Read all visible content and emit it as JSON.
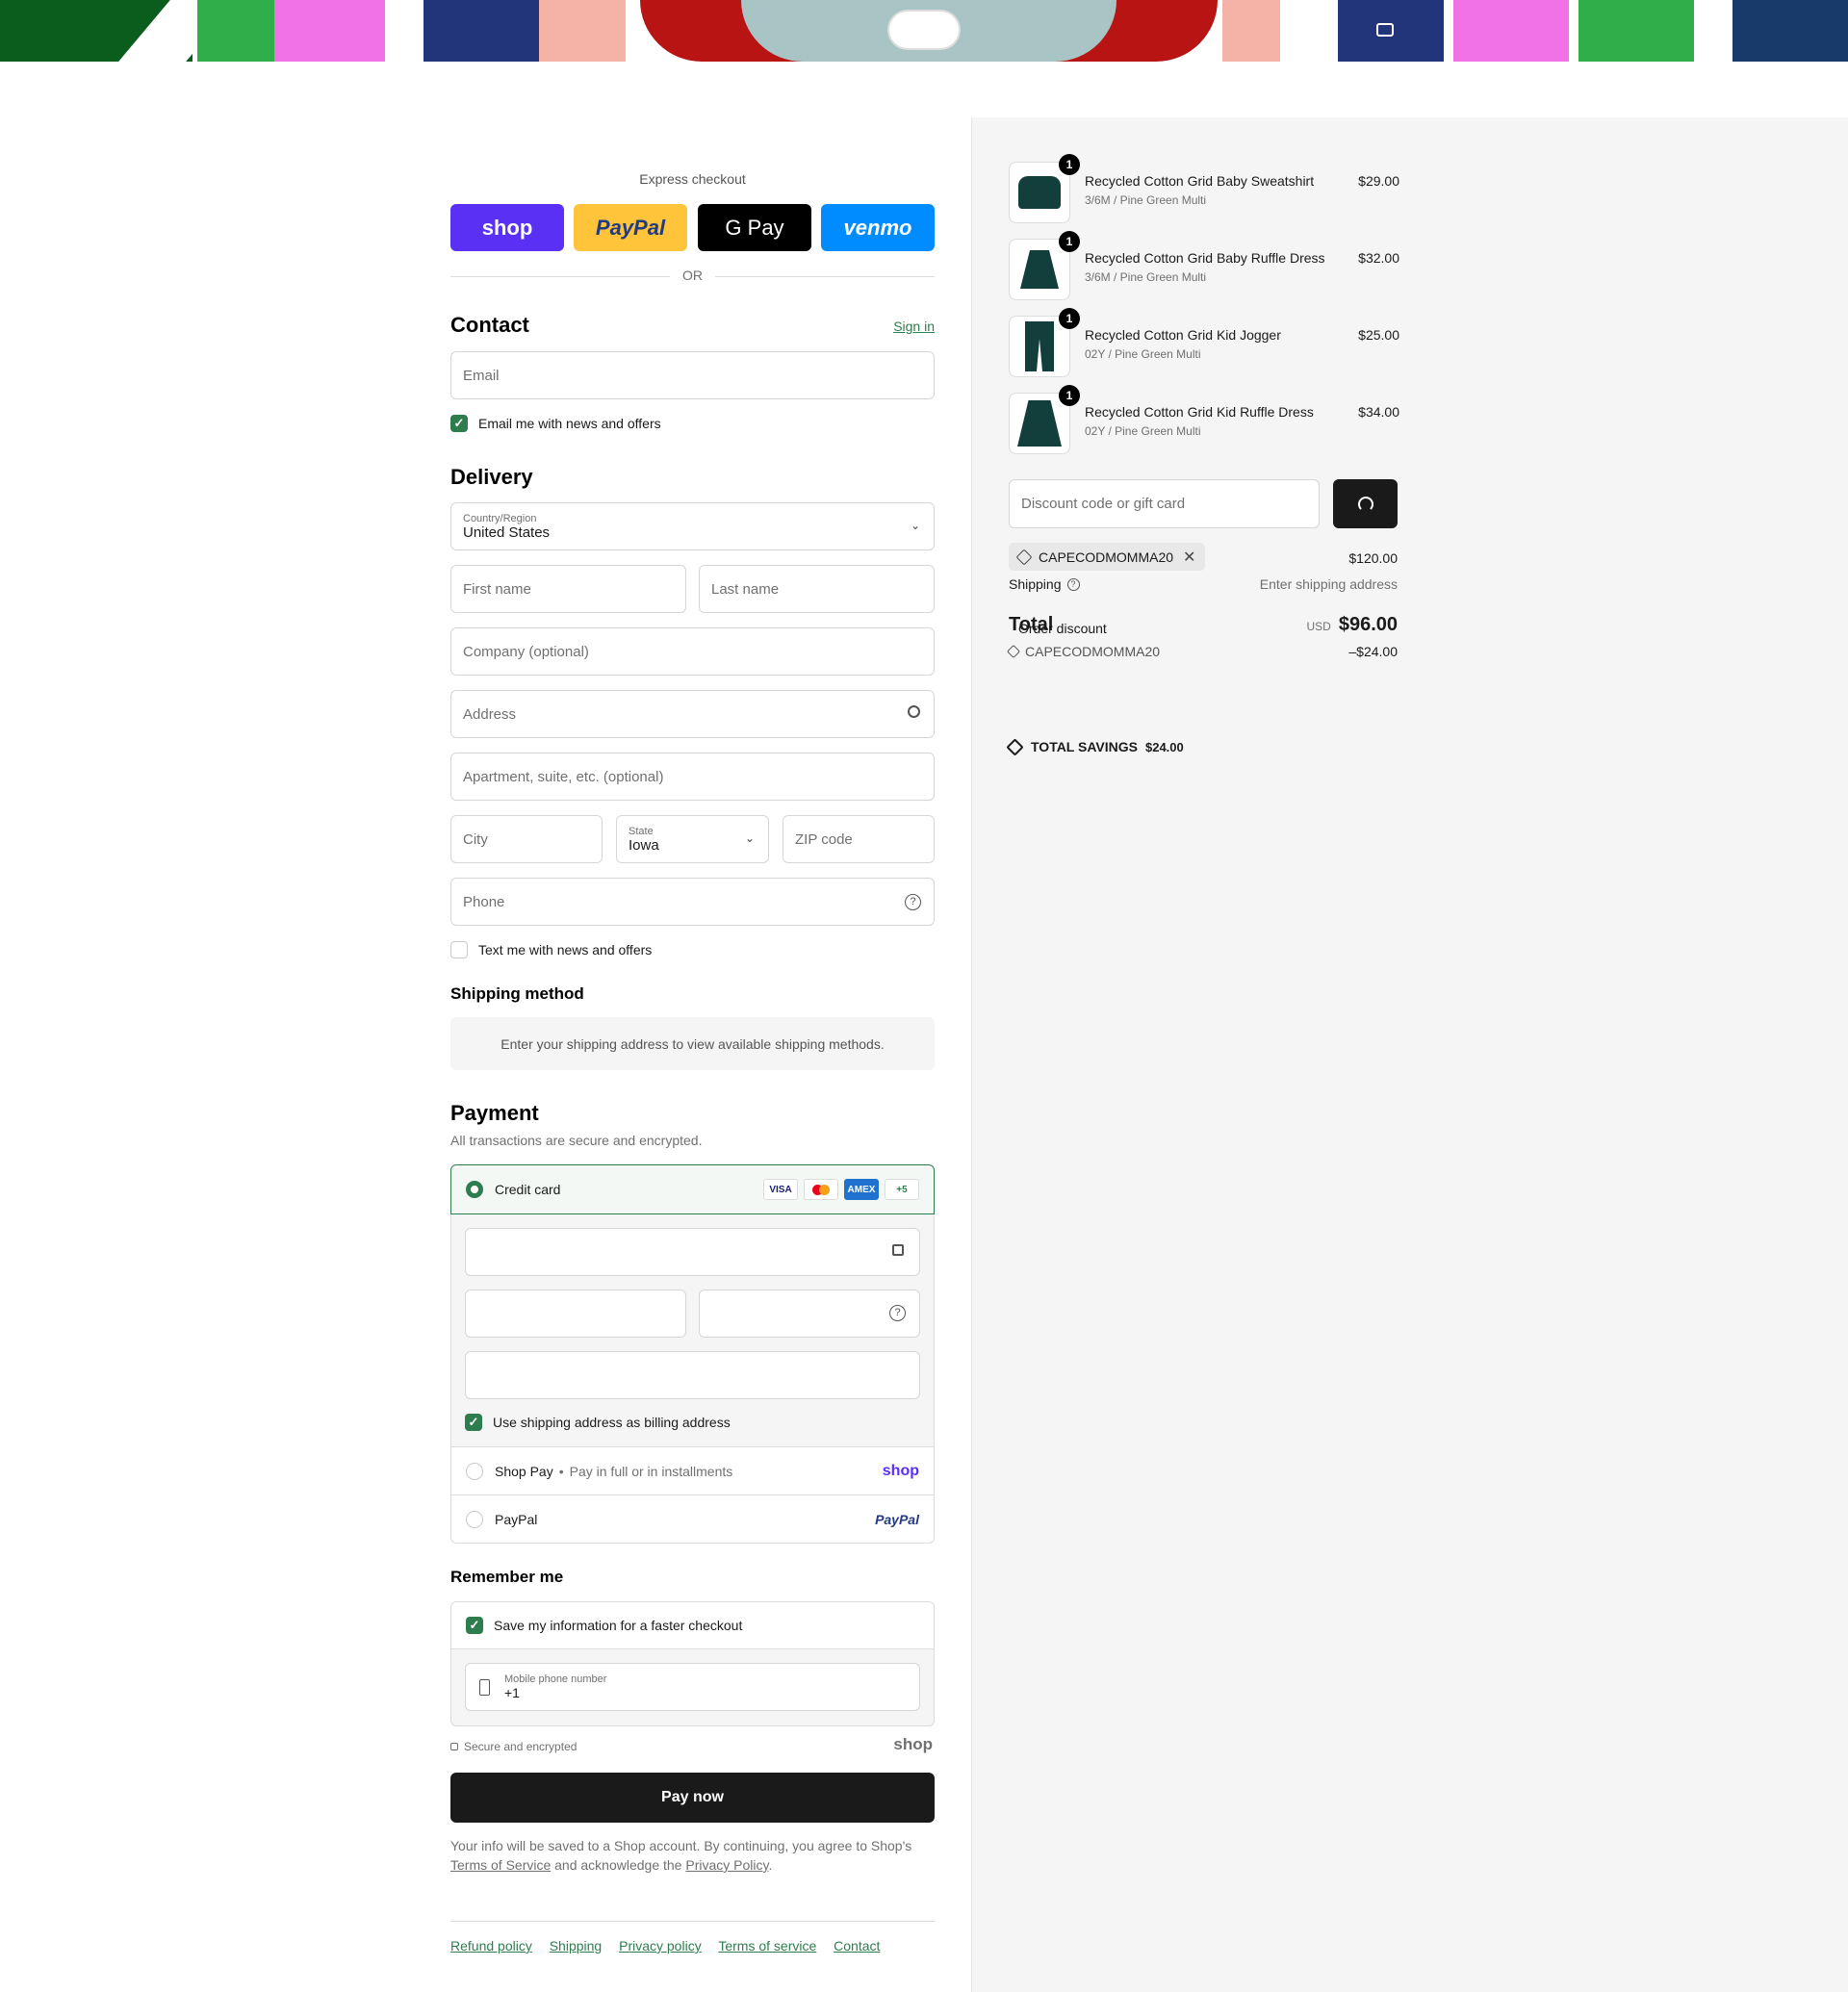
{
  "express": {
    "title": "Express checkout",
    "buttons": [
      "shop",
      "PayPal",
      "G Pay",
      "venmo"
    ],
    "or": "OR"
  },
  "contact": {
    "heading": "Contact",
    "sign_in": "Sign in",
    "email_placeholder": "Email",
    "email_news_label": "Email me with news and offers",
    "email_news_checked": true
  },
  "delivery": {
    "heading": "Delivery",
    "country_label": "Country/Region",
    "country_value": "United States",
    "first_name": "First name",
    "last_name": "Last name",
    "company": "Company (optional)",
    "address": "Address",
    "apartment": "Apartment, suite, etc. (optional)",
    "city": "City",
    "state_label": "State",
    "state_value": "Iowa",
    "zip": "ZIP code",
    "phone": "Phone",
    "text_news_label": "Text me with news and offers",
    "text_news_checked": false
  },
  "shipping_method": {
    "heading": "Shipping method",
    "message": "Enter your shipping address to view available shipping methods."
  },
  "payment": {
    "heading": "Payment",
    "subtitle": "All transactions are secure and encrypted.",
    "credit_card_label": "Credit card",
    "card_logos": [
      "VISA",
      "MC",
      "AMEX",
      "+5"
    ],
    "billing_label": "Use shipping address as billing address",
    "billing_checked": true,
    "shop_pay_label": "Shop Pay",
    "shop_pay_sub": "Pay in full or in installments",
    "shop_pay_logo": "shop",
    "paypal_label": "PayPal",
    "paypal_logo": "PayPal"
  },
  "remember": {
    "heading": "Remember me",
    "save_label": "Save my information for a faster checkout",
    "save_checked": true,
    "mobile_label": "Mobile phone number",
    "mobile_value": "+1",
    "secure_label": "Secure and encrypted",
    "shop_logo": "shop"
  },
  "pay_button": "Pay now",
  "legal": {
    "text1": "Your info will be saved to a Shop account. By continuing, you agree to Shop's",
    "tos": "Terms of Service",
    "text2": "and acknowledge the",
    "privacy": "Privacy Policy",
    "end": "."
  },
  "footer_links": [
    "Refund policy",
    "Shipping",
    "Privacy policy",
    "Terms of service",
    "Contact"
  ],
  "cart": {
    "items": [
      {
        "name": "Recycled Cotton Grid Baby Sweatshirt",
        "variant": "3/6M / Pine Green Multi",
        "price": "$29.00",
        "qty": "1",
        "icon": "sweatshirt-icon"
      },
      {
        "name": "Recycled Cotton Grid Baby Ruffle Dress",
        "variant": "3/6M / Pine Green Multi",
        "price": "$32.00",
        "qty": "1",
        "icon": "dress-icon"
      },
      {
        "name": "Recycled Cotton Grid Kid Jogger",
        "variant": "02Y / Pine Green Multi",
        "price": "$25.00",
        "qty": "1",
        "icon": "jogger-icon"
      },
      {
        "name": "Recycled Cotton Grid Kid Ruffle Dress",
        "variant": "02Y / Pine Green Multi",
        "price": "$34.00",
        "qty": "1",
        "icon": "dress-icon"
      }
    ],
    "discount_placeholder": "Discount code or gift card",
    "applied_code": "CAPECODMOMMA20",
    "subtotal": "$120.00",
    "shipping_label": "Shipping",
    "shipping_value": "Enter shipping address",
    "total_label": "Total",
    "order_discount_label": "Order discount",
    "currency": "USD",
    "total_value": "$96.00",
    "discount_code_line": "CAPECODMOMMA20",
    "discount_amount": "–$24.00",
    "savings_label": "TOTAL SAVINGS",
    "savings_value": "$24.00"
  },
  "colors": {
    "accent": "#2e7d4f",
    "shop_purple": "#5a31f4",
    "paypal_yellow": "#ffc439",
    "venmo_blue": "#008cff",
    "dark_button": "#1a1a1a"
  }
}
